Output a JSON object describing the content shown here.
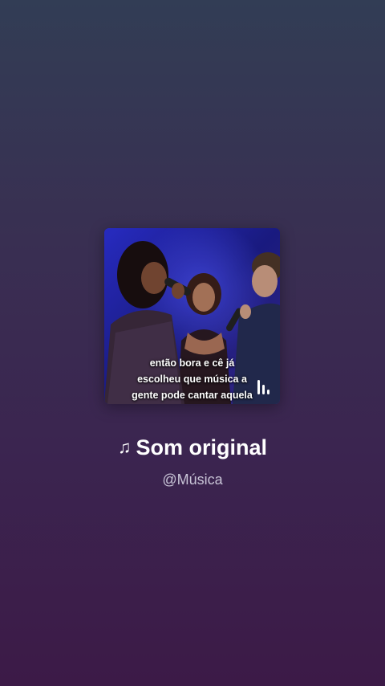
{
  "cover": {
    "caption_lines": [
      "então bora e cê já",
      "escolheu que música a",
      "gente pode cantar aquela"
    ],
    "icon": "audio-equalizer-icon"
  },
  "track": {
    "note_icon": "♫",
    "title": "Som original",
    "artist": "@Música"
  },
  "colors": {
    "background_top": "#323d55",
    "background_bottom": "#3c1a47",
    "title": "#ffffff",
    "artist": "#c8c4d6"
  }
}
